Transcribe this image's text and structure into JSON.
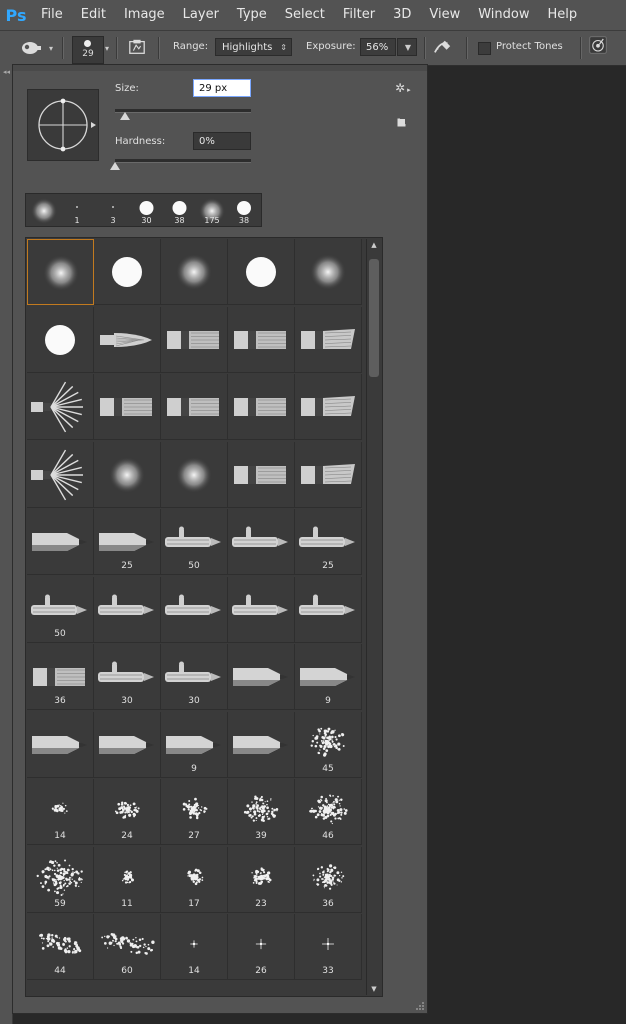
{
  "app": {
    "logo": "Ps"
  },
  "menu": [
    "File",
    "Edit",
    "Image",
    "Layer",
    "Type",
    "Select",
    "Filter",
    "3D",
    "View",
    "Window",
    "Help"
  ],
  "options": {
    "brush_size": "29",
    "range_label": "Range:",
    "range_value": "Highlights",
    "exposure_label": "Exposure:",
    "exposure_value": "56%",
    "protect_tones": "Protect Tones"
  },
  "panel": {
    "size_label": "Size:",
    "size_value": "29 px",
    "size_slider": 0.07,
    "hardness_label": "Hardness:",
    "hardness_value": "0%",
    "hardness_slider": 0.0
  },
  "recent": [
    {
      "kind": "soft",
      "num": ""
    },
    {
      "kind": "dot",
      "num": "1"
    },
    {
      "kind": "dot",
      "num": "3"
    },
    {
      "kind": "hard",
      "num": "30"
    },
    {
      "kind": "hard",
      "num": "38"
    },
    {
      "kind": "soft",
      "num": "175"
    },
    {
      "kind": "hard",
      "num": "38"
    }
  ],
  "brushes": [
    {
      "icon": "soft-round-icon",
      "num": "",
      "selected": true
    },
    {
      "icon": "hard-round-icon",
      "num": ""
    },
    {
      "icon": "soft-round-icon",
      "num": ""
    },
    {
      "icon": "hard-round-icon",
      "num": ""
    },
    {
      "icon": "soft-round-icon",
      "num": ""
    },
    {
      "icon": "hard-round-icon",
      "num": ""
    },
    {
      "icon": "pointed-bristle-icon",
      "num": ""
    },
    {
      "icon": "flat-bristle-icon",
      "num": ""
    },
    {
      "icon": "flat-bristle-icon",
      "num": ""
    },
    {
      "icon": "angled-bristle-icon",
      "num": ""
    },
    {
      "icon": "fan-bristle-icon",
      "num": ""
    },
    {
      "icon": "flat-bristle-icon",
      "num": ""
    },
    {
      "icon": "flat-bristle-icon",
      "num": ""
    },
    {
      "icon": "flat-bristle-icon",
      "num": ""
    },
    {
      "icon": "angled-bristle-icon",
      "num": ""
    },
    {
      "icon": "fan-bristle-icon",
      "num": ""
    },
    {
      "icon": "soft-round-icon",
      "num": ""
    },
    {
      "icon": "soft-round-icon",
      "num": ""
    },
    {
      "icon": "flat-bristle-icon",
      "num": ""
    },
    {
      "icon": "angled-bristle-icon",
      "num": ""
    },
    {
      "icon": "pencil-tip-icon",
      "num": ""
    },
    {
      "icon": "pencil-tip-icon",
      "num": "25"
    },
    {
      "icon": "airbrush-icon",
      "num": "50"
    },
    {
      "icon": "airbrush-icon",
      "num": ""
    },
    {
      "icon": "airbrush-icon",
      "num": "25"
    },
    {
      "icon": "airbrush-icon",
      "num": "50"
    },
    {
      "icon": "airbrush-icon",
      "num": ""
    },
    {
      "icon": "airbrush-icon",
      "num": ""
    },
    {
      "icon": "airbrush-icon",
      "num": ""
    },
    {
      "icon": "airbrush-icon",
      "num": ""
    },
    {
      "icon": "flat-bristle-icon",
      "num": "36"
    },
    {
      "icon": "airbrush-icon",
      "num": "30"
    },
    {
      "icon": "airbrush-icon",
      "num": "30"
    },
    {
      "icon": "pencil-tip-icon",
      "num": ""
    },
    {
      "icon": "pencil-tip-icon",
      "num": "9"
    },
    {
      "icon": "pencil-tip-icon",
      "num": ""
    },
    {
      "icon": "pencil-tip-icon",
      "num": ""
    },
    {
      "icon": "pencil-tip-icon",
      "num": "9"
    },
    {
      "icon": "pencil-tip-icon",
      "num": ""
    },
    {
      "icon": "spatter-icon",
      "num": "45"
    },
    {
      "icon": "spatter-icon",
      "num": "14"
    },
    {
      "icon": "spatter-icon",
      "num": "24"
    },
    {
      "icon": "spatter-icon",
      "num": "27"
    },
    {
      "icon": "spatter-icon",
      "num": "39"
    },
    {
      "icon": "spatter-icon",
      "num": "46"
    },
    {
      "icon": "spatter-icon",
      "num": "59"
    },
    {
      "icon": "spatter-icon",
      "num": "11"
    },
    {
      "icon": "spatter-icon",
      "num": "17"
    },
    {
      "icon": "spatter-icon",
      "num": "23"
    },
    {
      "icon": "spatter-icon",
      "num": "36"
    },
    {
      "icon": "chalk-icon",
      "num": "44"
    },
    {
      "icon": "chalk-icon",
      "num": "60"
    },
    {
      "icon": "star-spark-icon",
      "num": "14"
    },
    {
      "icon": "star-spark-icon",
      "num": "26"
    },
    {
      "icon": "star-spark-icon",
      "num": "33"
    }
  ]
}
